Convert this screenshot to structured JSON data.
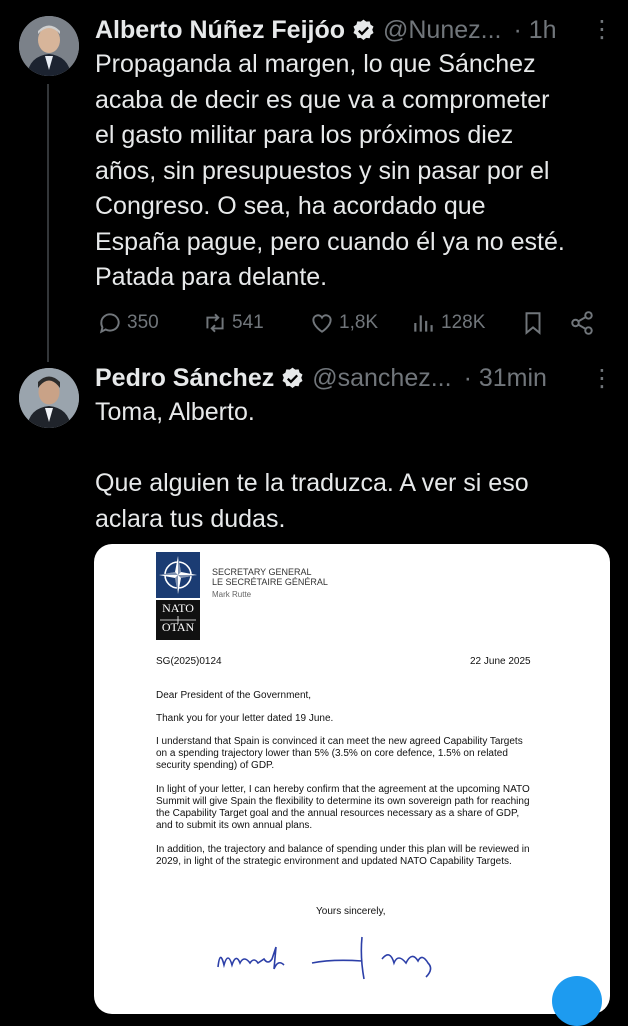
{
  "tweets": [
    {
      "name": "Alberto Núñez Feijóo",
      "handle": "@Nunez...",
      "time": "· 1h",
      "text": "Propaganda al margen, lo que Sánchez\nacaba de decir es que va a comprometer\nel gasto militar para los próximos diez\naños, sin presupuestos y sin pasar por el\nCongreso. O sea, ha acordado que\nEspaña pague, pero cuando él ya no esté.\nPatada para delante.",
      "replies": "350",
      "reposts": "541",
      "likes": "1,8K",
      "views": "128K"
    },
    {
      "name": "Pedro Sánchez",
      "handle": "@sanchez...",
      "time": "· 31min",
      "text": "Toma, Alberto.\n\nQue alguien te la traduzca. A ver si eso\naclara tus dudas."
    }
  ],
  "letter": {
    "logo_top": "NATO",
    "logo_bottom": "OTAN",
    "office_en": "SECRETARY GENERAL",
    "office_fr": "LE SECRÉTAIRE GÉNÉRAL",
    "office_name": "Mark Rutte",
    "reference": "SG(2025)0124",
    "date": "22 June 2025",
    "salutation": "Dear President of the Government,",
    "para1": "Thank you for your letter dated 19 June.",
    "para2": "I understand that Spain is convinced it can meet the new agreed Capability Targets on a spending trajectory lower than 5% (3.5% on core defence, 1.5% on related security spending) of GDP.",
    "para3": "In light of your letter, I can hereby confirm that the agreement at the upcoming NATO Summit will give Spain the flexibility to determine its own sovereign path for reaching the Capability Target goal and the annual resources necessary as a share of GDP, and to submit its own annual plans.",
    "para4": "In addition, the trajectory and balance of spending under this plan will be reviewed in 2029, in light of the strategic environment and updated NATO Capability Targets.",
    "closing": "Yours sincerely,"
  },
  "colors": {
    "background": "#000000",
    "text": "#e7e9ea",
    "muted": "#71767b",
    "verified": "#1d9bf0",
    "nato_blue": "#1b3c73"
  },
  "icons": [
    "verified-badge-icon",
    "more-icon",
    "reply-icon",
    "repost-icon",
    "like-icon",
    "views-icon",
    "bookmark-icon",
    "share-icon"
  ]
}
